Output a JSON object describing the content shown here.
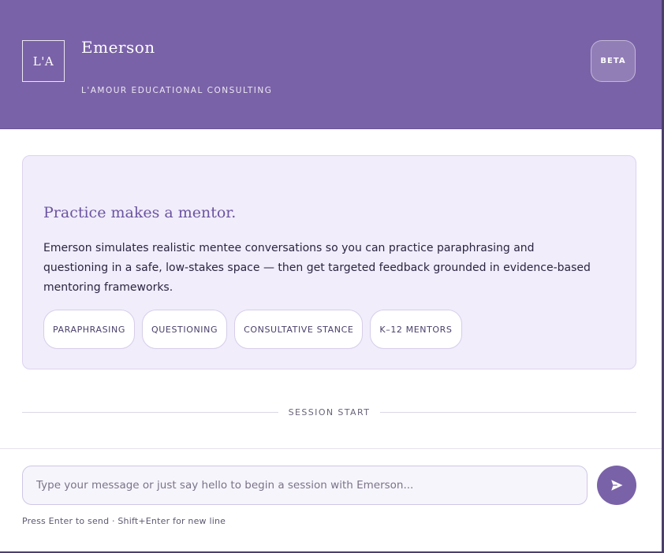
{
  "header": {
    "logo_text": "L'A",
    "title": "Emerson",
    "subtitle": "L'AMOUR EDUCATIONAL CONSULTING",
    "badge": "BETA"
  },
  "intro": {
    "heading": "Practice makes a mentor.",
    "body": "Emerson simulates realistic mentee conversations so you can practice paraphrasing and questioning in a safe, low-stakes space — then get targeted feedback grounded in evidence-based mentoring frameworks.",
    "tags": [
      "PARAPHRASING",
      "QUESTIONING",
      "CONSULTATIVE STANCE",
      "K–12 MENTORS"
    ]
  },
  "session": {
    "divider_label": "SESSION START"
  },
  "composer": {
    "input_value": "",
    "placeholder": "Type your message or just say hello to begin a session with Emerson...",
    "send_icon": "send-icon",
    "hint": "Press Enter to send · Shift+Enter for new line"
  },
  "colors": {
    "brand": "#7a62a8",
    "card_bg": "#f1edfb",
    "heading_accent": "#6b54a0"
  }
}
